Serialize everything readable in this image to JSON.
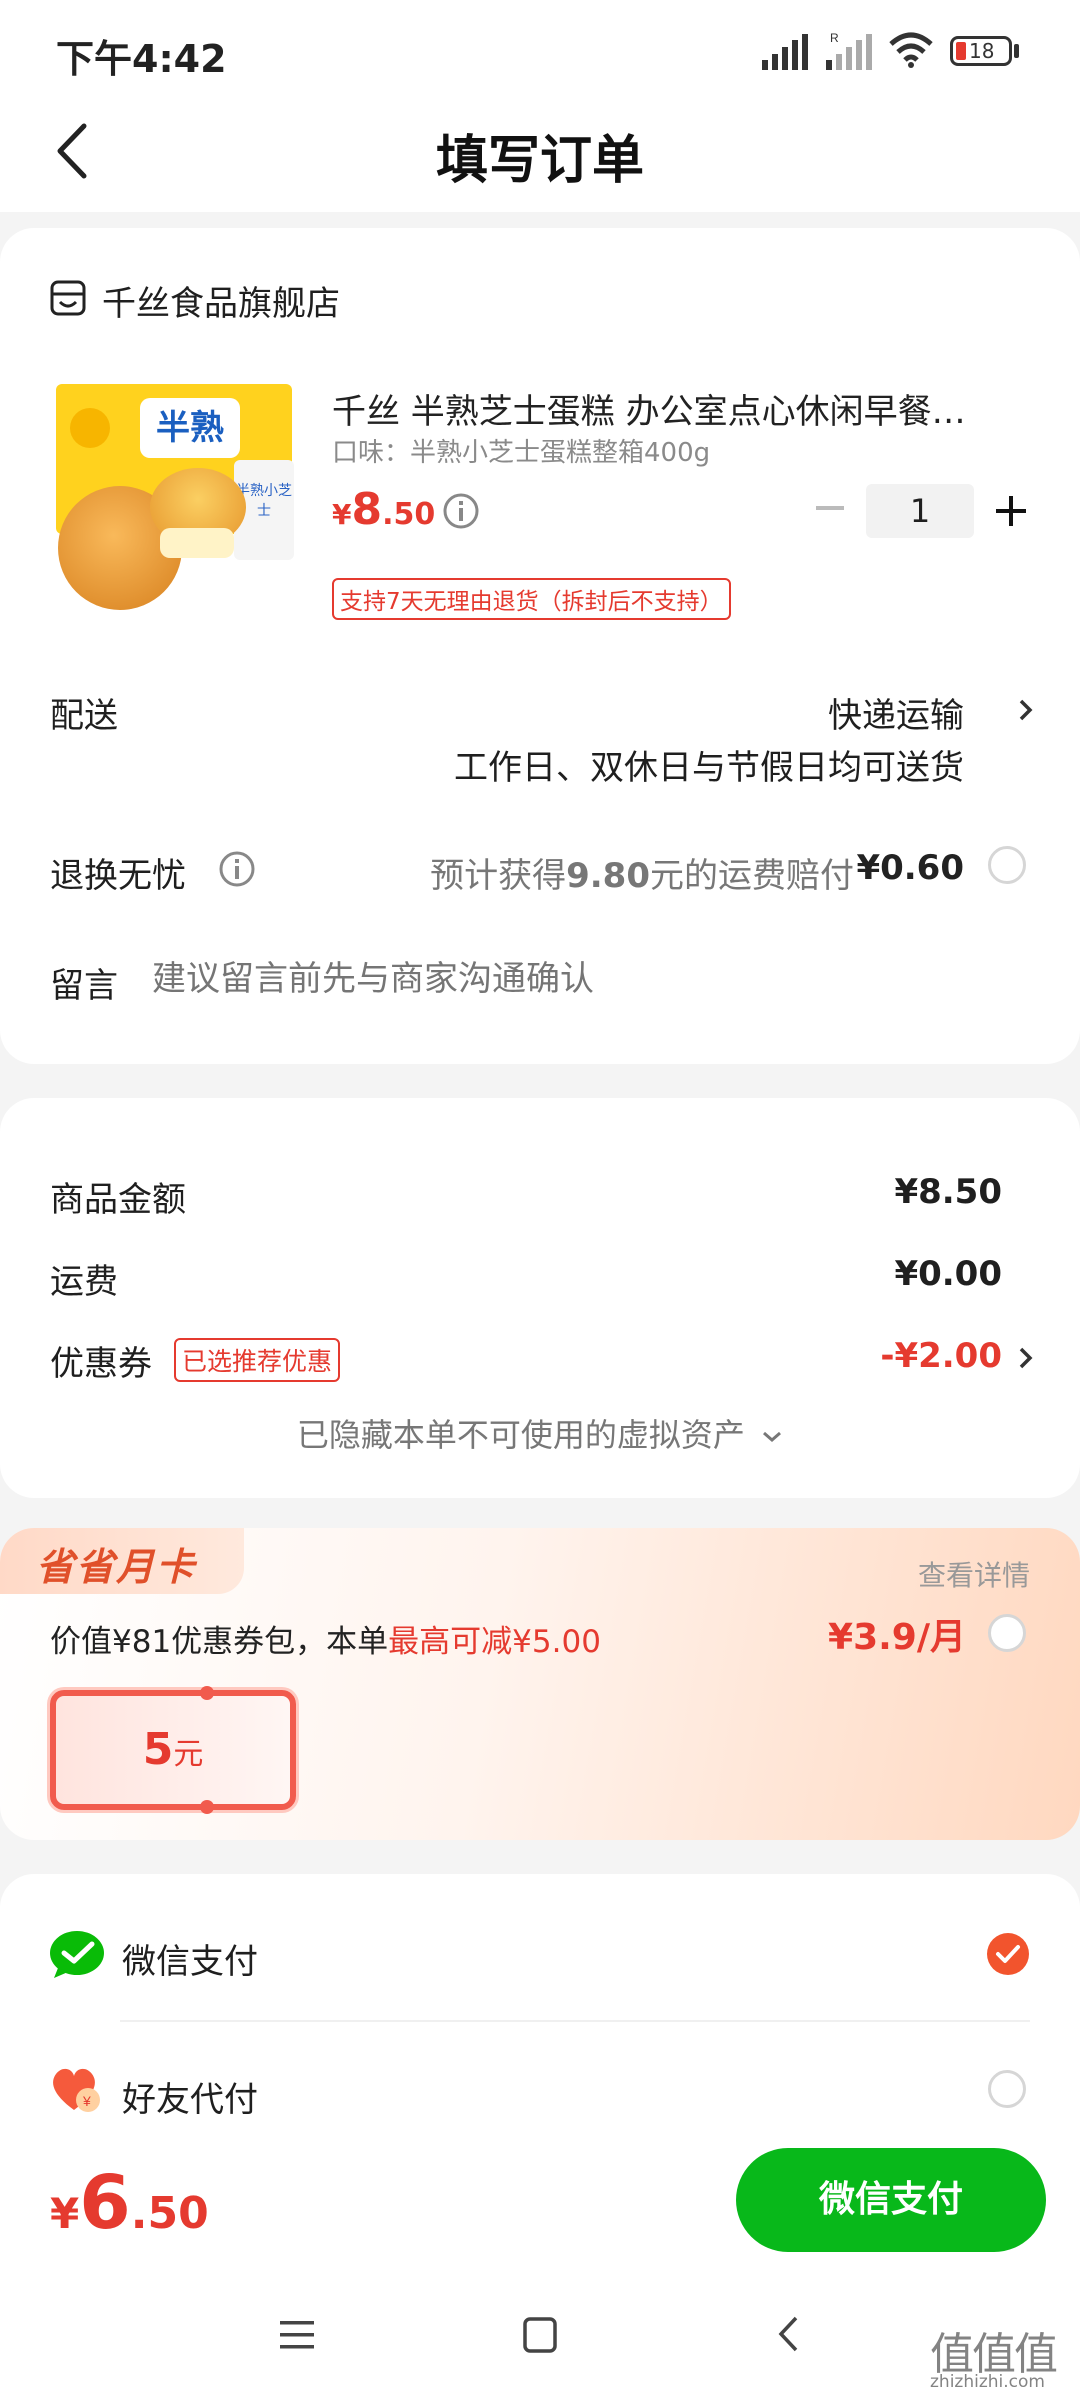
{
  "status_bar": {
    "time": "下午4:42",
    "battery": "18"
  },
  "header": {
    "title": "填写订单"
  },
  "shop": {
    "name": "千丝食品旗舰店"
  },
  "product": {
    "title": "千丝 半熟芝士蛋糕 办公室点心休闲早餐…",
    "flavor": "口味：半熟小芝士蛋糕整箱400g",
    "price_symbol": "¥",
    "price_int": "8",
    "price_dec": ".50",
    "quantity": "1",
    "return_tag": "支持7天无理由退货（拆封后不支持）",
    "image_label_1": "半熟",
    "image_label_2": "半熟小芝士"
  },
  "delivery": {
    "label": "配送",
    "method": "快递运输",
    "note": "工作日、双休日与节假日均可送货"
  },
  "return_insurance": {
    "label": "退换无忧",
    "desc_pre": "预计获得",
    "desc_amount": "9.80",
    "desc_post": "元的运费赔付",
    "price": "¥0.60"
  },
  "message": {
    "label": "留言",
    "placeholder": "建议留言前先与商家沟通确认"
  },
  "summary": {
    "goods_label": "商品金额",
    "goods_value": "¥8.50",
    "shipping_label": "运费",
    "shipping_value": "¥0.00",
    "coupon_label": "优惠券",
    "coupon_tag": "已选推荐优惠",
    "coupon_value": "-¥2.00",
    "hidden_assets": "已隐藏本单不可使用的虚拟资产"
  },
  "monthly_card": {
    "badge": "省省月卡",
    "details": "查看详情",
    "desc_pre": "价值¥81优惠券包，本单",
    "desc_highlight": "最高可减¥5.00",
    "price": "¥3.9/月",
    "coupon_value": "5",
    "coupon_unit": "元"
  },
  "payment": {
    "wechat": "微信支付",
    "friend": "好友代付"
  },
  "footer": {
    "total_symbol": "¥",
    "total_int": "6",
    "total_dec": ".50",
    "pay_button": "微信支付"
  },
  "watermark": {
    "text": "值值值",
    "url": "zhizhizhi.com"
  },
  "colors": {
    "accent_red": "#e53a2f",
    "wechat_green": "#09bb07",
    "pay_green": "#08b81a"
  }
}
